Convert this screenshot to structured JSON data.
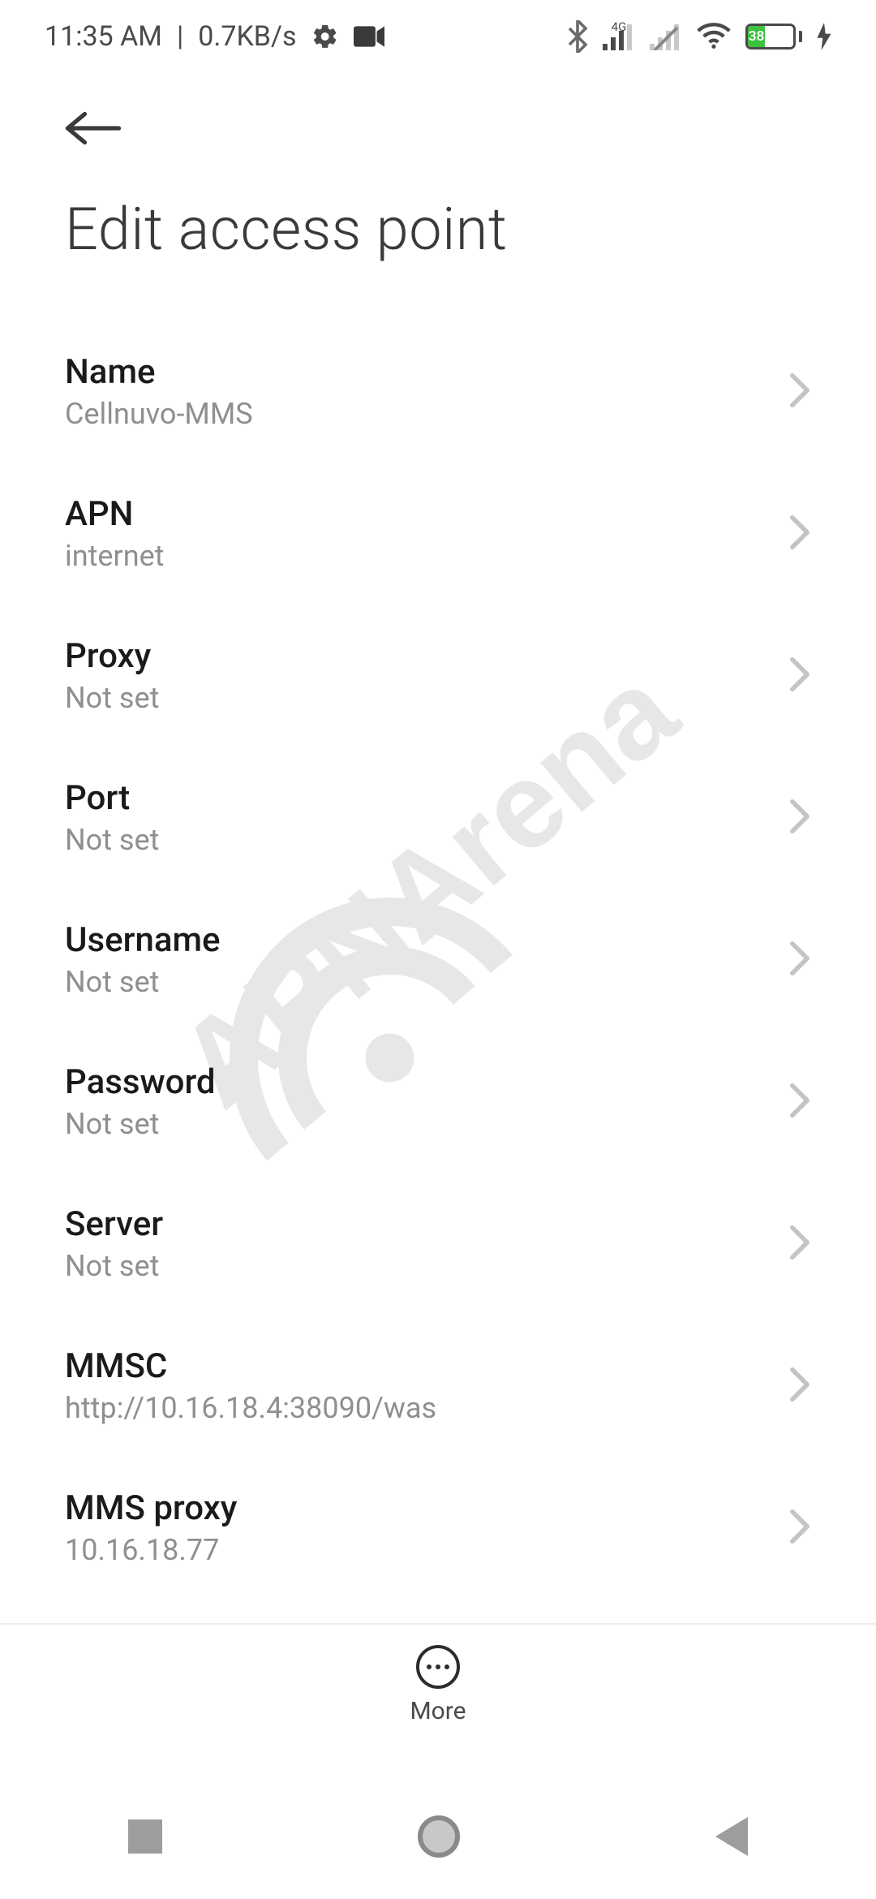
{
  "statusbar": {
    "time": "11:35 AM",
    "separator": "|",
    "speed": "0.7KB/s",
    "netlabel": "4G",
    "battery_pct": "38"
  },
  "header": {
    "title": "Edit access point"
  },
  "settings": [
    {
      "label": "Name",
      "value": "Cellnuvo-MMS"
    },
    {
      "label": "APN",
      "value": "internet"
    },
    {
      "label": "Proxy",
      "value": "Not set"
    },
    {
      "label": "Port",
      "value": "Not set"
    },
    {
      "label": "Username",
      "value": "Not set"
    },
    {
      "label": "Password",
      "value": "Not set"
    },
    {
      "label": "Server",
      "value": "Not set"
    },
    {
      "label": "MMSC",
      "value": "http://10.16.18.4:38090/was"
    },
    {
      "label": "MMS proxy",
      "value": "10.16.18.77"
    }
  ],
  "toolbar": {
    "more_label": "More"
  },
  "watermark_text": "APNArena"
}
